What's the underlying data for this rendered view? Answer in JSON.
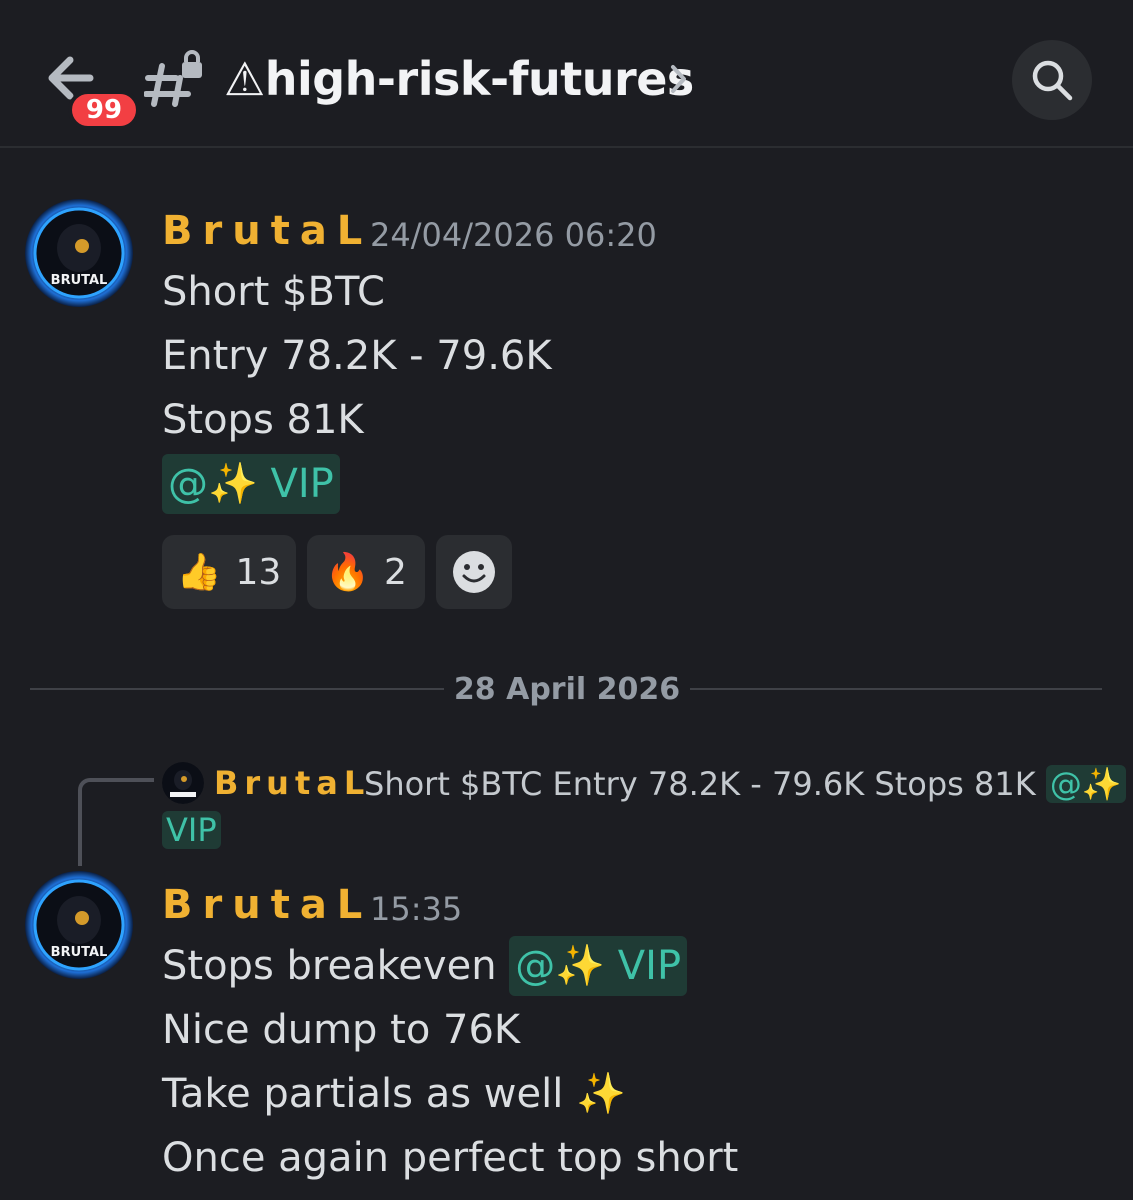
{
  "header": {
    "back_label": "Back",
    "unread_badge": "99",
    "channel_name": "⚠high-risk-futures"
  },
  "messages": [
    {
      "author": "BrutaL",
      "timestamp": "24/04/2026 06:20",
      "lines": [
        "Short $BTC",
        "Entry 78.2K - 79.6K",
        "Stops 81K"
      ],
      "mention": "@✨ VIP",
      "reactions": [
        {
          "emoji": "👍",
          "count": "13"
        },
        {
          "emoji": "🔥",
          "count": "2"
        }
      ],
      "avatar_text": "BRUTAL"
    },
    {
      "author": "BrutaL",
      "timestamp": "15:35",
      "reply": {
        "author": "BrutaL",
        "text": "Short $BTC Entry 78.2K - 79.6K Stops 81K",
        "mention_a": "@✨",
        "mention_b": "VIP"
      },
      "line1_text": "Stops breakeven",
      "line1_mention": "@✨ VIP",
      "lines": [
        "Nice dump to 76K",
        "Take partials as well ✨",
        "Once again perfect top short"
      ],
      "avatar_text": "BRUTAL"
    }
  ],
  "date_divider": "28 April 2026",
  "colors": {
    "background": "#1c1d22",
    "username": "#f0b132",
    "mention_text": "#3fc2a8",
    "mention_bg": "#1f3b35",
    "badge": "#f23f43"
  }
}
